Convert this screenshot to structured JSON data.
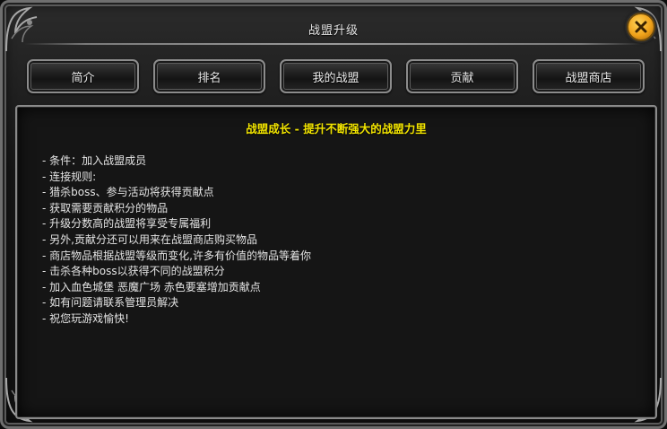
{
  "window": {
    "title": "战盟升级",
    "close_icon": "close-icon",
    "accent_color": "#f0a21a"
  },
  "tabs": [
    {
      "label": "简介"
    },
    {
      "label": "排名"
    },
    {
      "label": "我的战盟"
    },
    {
      "label": "贡献"
    },
    {
      "label": "战盟商店"
    }
  ],
  "content": {
    "headline": "战盟成长 - 提升不断强大的战盟力里",
    "headline_color": "#f2e400",
    "lines": [
      "- 条件：加入战盟成员",
      "- 连接规则:",
      "- 猎杀boss、参与活动将获得贡献点",
      "- 获取需要贡献积分的物品",
      "- 升级分数高的战盟将享受专属福利",
      "- 另外,贡献分还可以用来在战盟商店购买物品",
      "- 商店物品根据战盟等级而变化,许多有价值的物品等着你",
      "- 击杀各种boss以获得不同的战盟积分",
      "- 加入血色城堡 恶魔广场 赤色要塞增加贡献点",
      "- 如有问题请联系管理员解决",
      "- 祝您玩游戏愉快!"
    ]
  }
}
